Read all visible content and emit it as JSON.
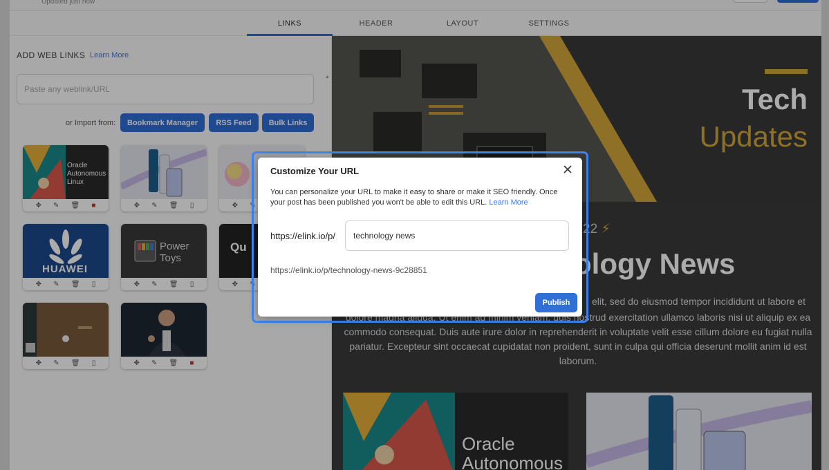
{
  "top": {
    "updated_text": "Updated just now"
  },
  "tabs": [
    {
      "label": "LINKS",
      "active": true
    },
    {
      "label": "HEADER",
      "active": false
    },
    {
      "label": "LAYOUT",
      "active": false
    },
    {
      "label": "SETTINGS",
      "active": false
    }
  ],
  "left_panel": {
    "title": "ADD WEB LINKS",
    "learn_more": "Learn More",
    "input_placeholder": "Paste any weblink/URL",
    "import_label": "or Import from:",
    "import_buttons": [
      "Bookmark Manager",
      "RSS Feed",
      "Bulk Links"
    ],
    "cards": [
      {
        "caption": "Oracle Autonomous Linux",
        "bookmarked": true
      },
      {
        "caption": "",
        "bookmarked": false
      },
      {
        "caption": "",
        "bookmarked": false
      },
      {
        "caption": "HUAWEI",
        "bookmarked": false
      },
      {
        "caption": "Power Toys",
        "bookmarked": false
      },
      {
        "caption": "Qu",
        "bookmarked": false
      },
      {
        "caption": "",
        "bookmarked": false
      },
      {
        "caption": "",
        "bookmarked": true
      }
    ]
  },
  "preview": {
    "hero_title": "Tech",
    "hero_subtitle": "Updates",
    "date_fragment": "22",
    "headline_fragment": "ology News",
    "lorem_line1": "elit, sed do eiusmod tempor incididunt ut labore et",
    "lorem_rest": "dolore magna aliqua. Ut enim ad minim veniam, quis nostrud exercitation ullamco laboris nisi ut aliquip ex ea commodo consequat. Duis aute irure dolor in reprehenderit in voluptate velit esse cillum dolore eu fugiat nulla pariatur. Excepteur sint occaecat cupidatat non proident, sunt in culpa qui officia deserunt mollit anim id est laborum.",
    "bottom_caption": "Oracle Autonomous"
  },
  "dialog": {
    "title": "Customize Your URL",
    "description": "You can personalize your URL to make it easy to share or make it SEO friendly. Once your post has been published you won't be able to edit this URL.",
    "learn_more": "Learn More",
    "prefix": "https://elink.io/p/",
    "slug_value": "technology news",
    "full_url": "https://elink.io/p/technology-news-9c28851",
    "publish_label": "Publish"
  },
  "colors": {
    "accent": "#2f6fd6",
    "gold": "#d4a73a",
    "dialog_outline": "#3d86f0"
  }
}
